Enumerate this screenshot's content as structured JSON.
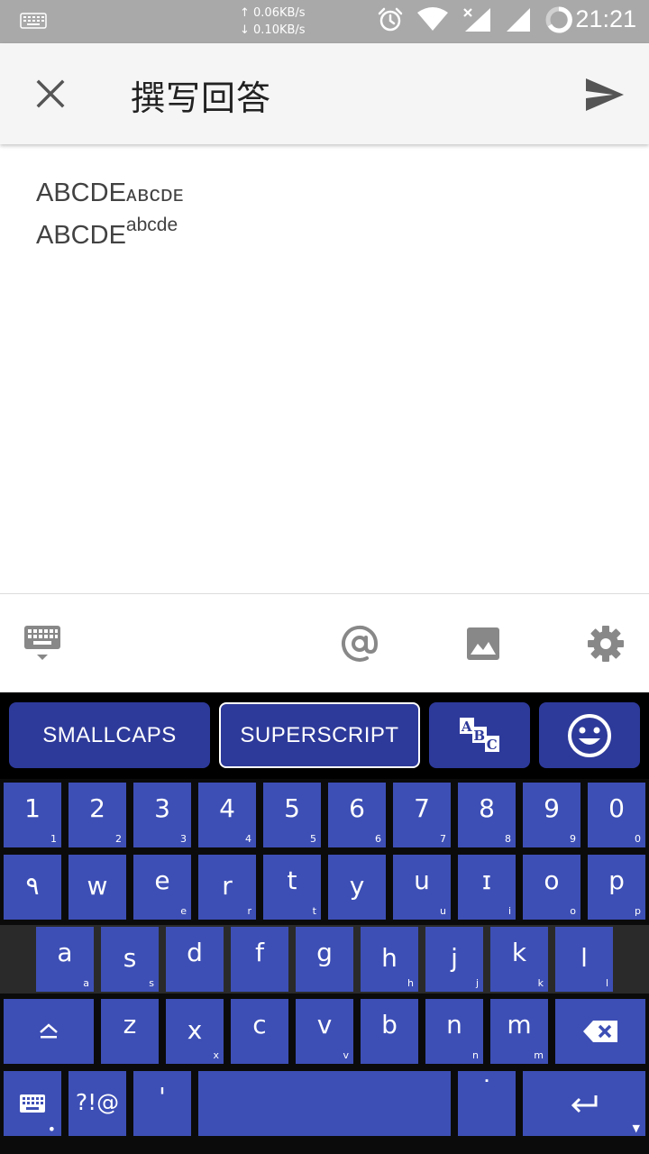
{
  "status_bar": {
    "upload_speed": "↑ 0.06KB/s",
    "download_speed": "↓ 0.10KB/s",
    "time": "21:21",
    "icons": [
      "keyboard-notification-icon",
      "alarm-icon",
      "wifi-icon",
      "no-signal-icon",
      "signal-icon",
      "battery-icon"
    ]
  },
  "app_bar": {
    "title": "撰写回答",
    "close_icon": "close-icon",
    "send_icon": "send-icon"
  },
  "editor": {
    "line1_base": "ABCDE",
    "line1_smallcaps": "ᴀʙᴄᴅᴇ",
    "line2_base": "ABCDE",
    "line2_superscript": "abcde"
  },
  "toolbar": {
    "icons": [
      "keyboard-hide-icon",
      "mention-icon",
      "image-icon",
      "settings-icon"
    ]
  },
  "keyboard": {
    "suggestions": {
      "smallcaps": "SMALLCAPS",
      "superscript": "SUPERSCRIPT",
      "abc_icon": "abc-style-icon",
      "emoji_icon": "emoji-icon",
      "selected": "SUPERSCRIPT"
    },
    "row_numbers": [
      {
        "main": "1",
        "hint": "1"
      },
      {
        "main": "2",
        "hint": "2"
      },
      {
        "main": "3",
        "hint": "3"
      },
      {
        "main": "4",
        "hint": "4"
      },
      {
        "main": "5",
        "hint": "5"
      },
      {
        "main": "6",
        "hint": "6"
      },
      {
        "main": "7",
        "hint": "7"
      },
      {
        "main": "8",
        "hint": "8"
      },
      {
        "main": "9",
        "hint": "9"
      },
      {
        "main": "0",
        "hint": "0"
      }
    ],
    "row_top": [
      {
        "main": "٩",
        "hint": ""
      },
      {
        "main": "w",
        "hint": ""
      },
      {
        "main": "e",
        "hint": "e"
      },
      {
        "main": "r",
        "hint": "r"
      },
      {
        "main": "t",
        "hint": "t"
      },
      {
        "main": "y",
        "hint": ""
      },
      {
        "main": "u",
        "hint": "u"
      },
      {
        "main": "ɪ",
        "hint": "i"
      },
      {
        "main": "o",
        "hint": "o"
      },
      {
        "main": "p",
        "hint": "p"
      }
    ],
    "row_home": [
      {
        "main": "a",
        "hint": "a"
      },
      {
        "main": "s",
        "hint": "s"
      },
      {
        "main": "d",
        "hint": ""
      },
      {
        "main": "f",
        "hint": ""
      },
      {
        "main": "g",
        "hint": ""
      },
      {
        "main": "h",
        "hint": "h"
      },
      {
        "main": "j",
        "hint": "j"
      },
      {
        "main": "k",
        "hint": "k"
      },
      {
        "main": "l",
        "hint": "l"
      }
    ],
    "row_bottom": [
      {
        "main": "z",
        "hint": ""
      },
      {
        "main": "x",
        "hint": "x"
      },
      {
        "main": "c",
        "hint": ""
      },
      {
        "main": "v",
        "hint": "v"
      },
      {
        "main": "b",
        "hint": ""
      },
      {
        "main": "n",
        "hint": "n"
      },
      {
        "main": "m",
        "hint": "m"
      }
    ],
    "shift_icon": "shift-icon",
    "backspace_icon": "backspace-icon",
    "symbols_label": "?!@",
    "apostrophe_label": "'",
    "period_label": "˙",
    "keyboard_switch_icon": "keyboard-switch-icon",
    "enter_icon": "enter-icon",
    "colors": {
      "key": "#3d4fb5",
      "suggestion": "#2e3a9a",
      "background": "#0b0b0b"
    }
  }
}
